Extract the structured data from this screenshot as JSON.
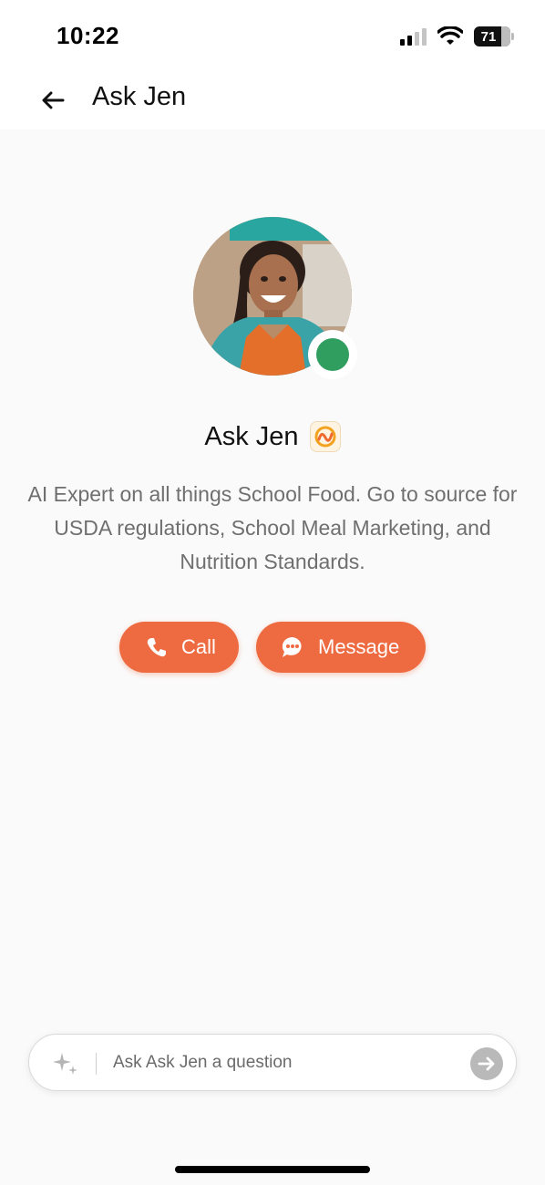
{
  "status_bar": {
    "time": "10:22",
    "battery_level": "71"
  },
  "header": {
    "title": "Ask Jen",
    "back_icon": "arrow-left-icon"
  },
  "profile": {
    "name": "Ask Jen",
    "online": true,
    "online_color": "#2f9e5f",
    "badge_icon": "app-badge-icon",
    "description": "AI Expert on all things School Food. Go to source for USDA regulations, School Meal Marketing, and Nutrition Standards."
  },
  "actions": {
    "call_label": "Call",
    "call_icon": "phone-icon",
    "message_label": "Message",
    "message_icon": "chat-bubble-icon",
    "accent_color": "#ee6a40"
  },
  "composer": {
    "placeholder": "Ask Ask Jen a question",
    "sparkle_icon": "sparkle-icon",
    "send_icon": "arrow-right-icon"
  }
}
